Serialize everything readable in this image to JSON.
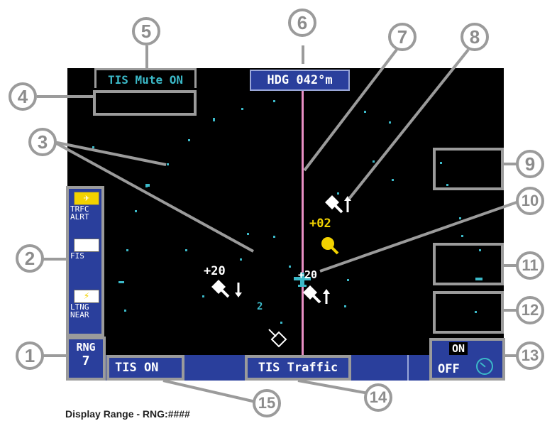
{
  "colors": {
    "screen_bg": "#000000",
    "bar_blue": "#2a3f9c",
    "cyan": "#3bb9c8",
    "magenta": "#e98fc4",
    "traffic_yellow": "#f2d200",
    "callout_gray": "#9b9b9b"
  },
  "top": {
    "tis_mute": "TIS Mute ON",
    "heading_label": "HDG",
    "heading_value": "042°m"
  },
  "sidebar": {
    "items": [
      {
        "icon": "traffic-alert-icon",
        "label1": "TRFC",
        "label2": "ALRT"
      },
      {
        "icon": "fis-icon",
        "label1": "FIS",
        "label2": ""
      },
      {
        "icon": "lightning-icon",
        "label1": "LTNG",
        "label2": "NEAR"
      }
    ]
  },
  "bottom": {
    "rng_label": "RNG",
    "rng_value": "7",
    "tis_status": "TIS ON",
    "traffic_button": "TIS Traffic",
    "on_label": "ON",
    "off_label": "OFF"
  },
  "traffic": {
    "alert_alt": "+02",
    "left_alt": "+20",
    "center_alt": "+20",
    "range_ring_label": "2"
  },
  "callouts": [
    "1",
    "2",
    "3",
    "4",
    "5",
    "6",
    "7",
    "8",
    "9",
    "10",
    "11",
    "12",
    "13",
    "14",
    "15"
  ],
  "footer_text": "Display Range - RNG:####"
}
